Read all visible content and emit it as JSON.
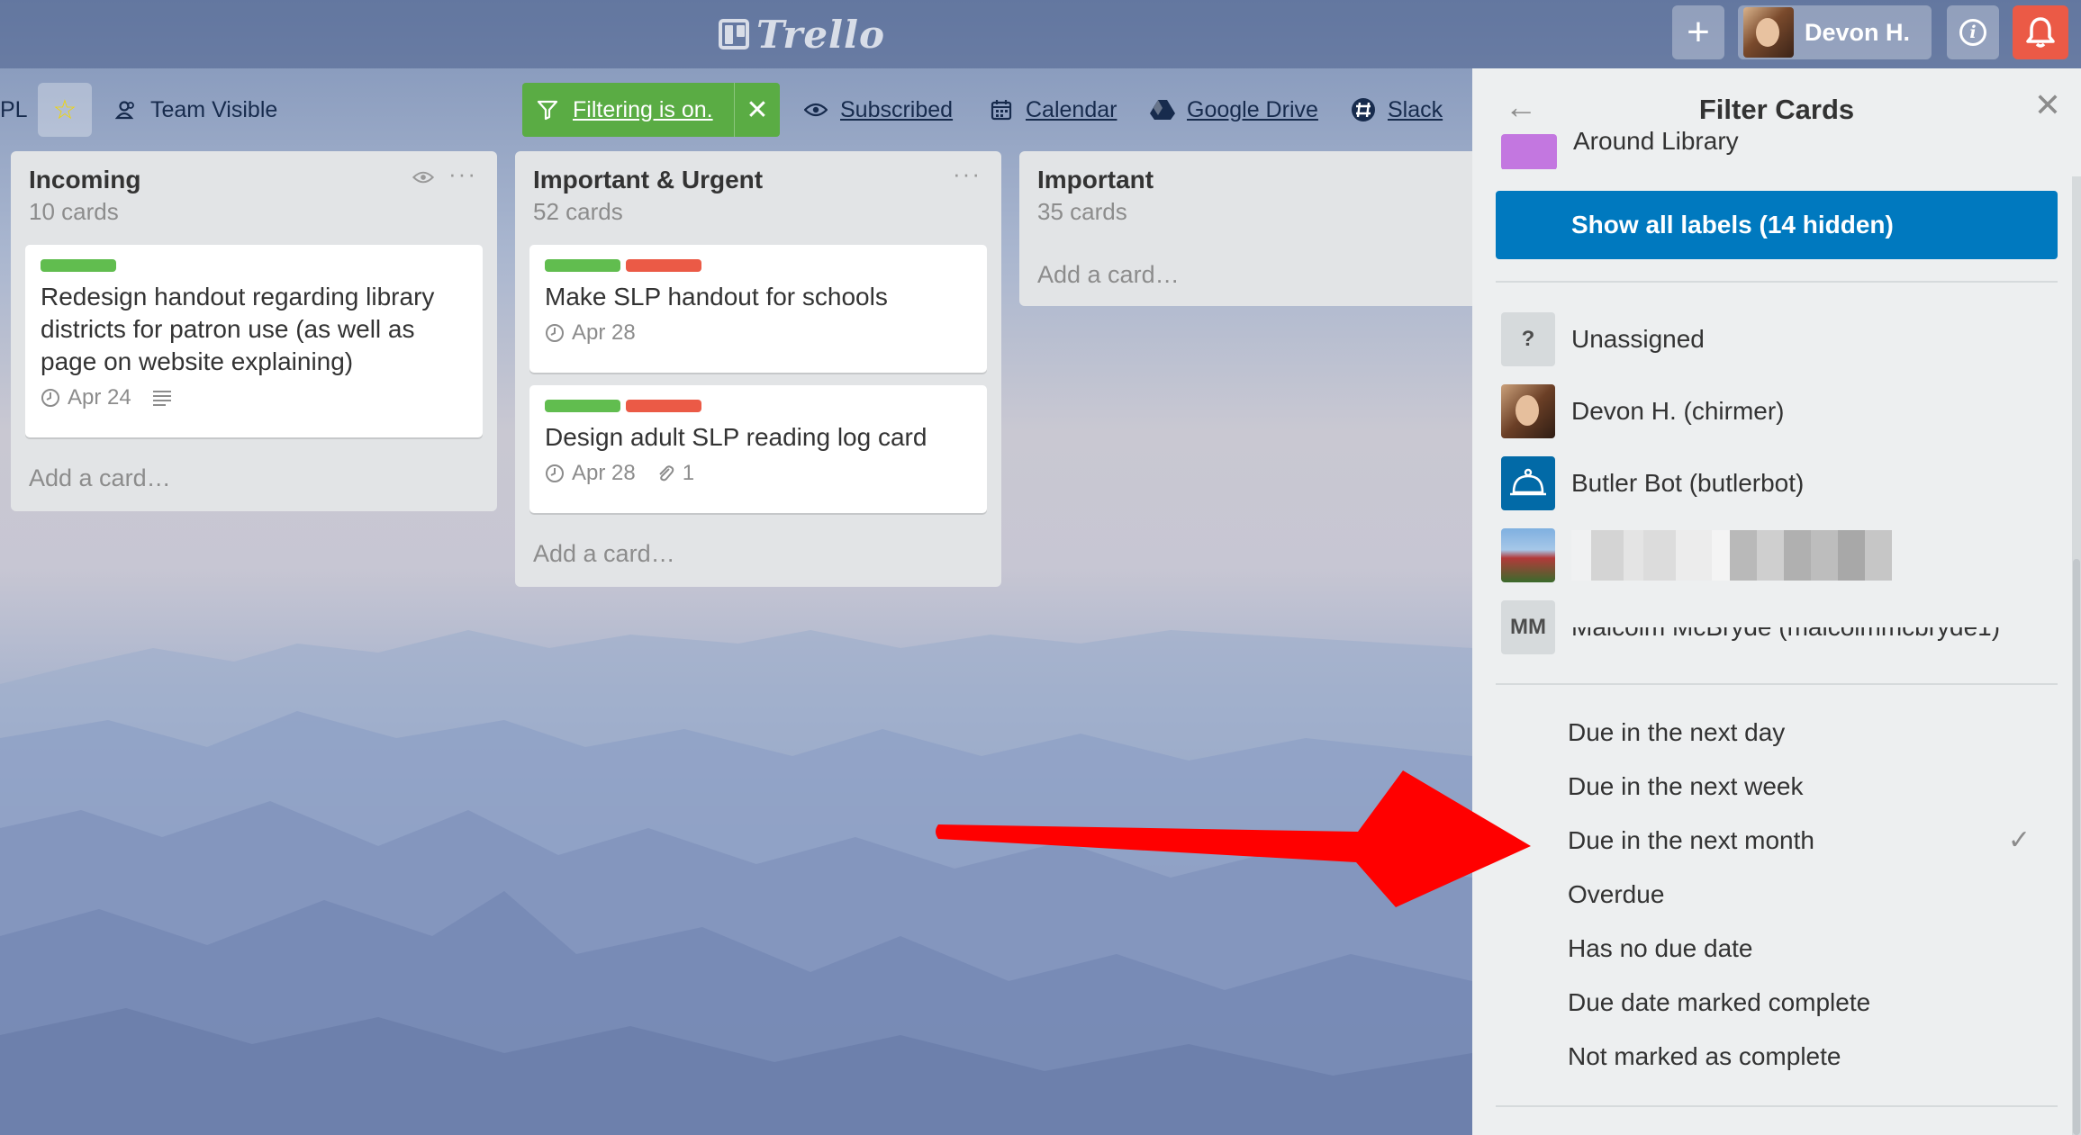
{
  "header": {
    "logo_text": "Trello",
    "plus_label": "+",
    "user_name": "Devon H.",
    "info_label": "i"
  },
  "boardbar": {
    "board_name_fragment": "PL",
    "visibility": "Team Visible",
    "filter_label": "Filtering is on.",
    "filter_clear": "✕",
    "subscribed": "Subscribed",
    "calendar": "Calendar",
    "google_drive": "Google Drive",
    "slack": "Slack"
  },
  "lists": [
    {
      "title": "Incoming",
      "count": "10 cards",
      "add_card": "Add a card…",
      "cards": [
        {
          "labels": [
            "#61bd4f"
          ],
          "title": "Redesign handout regarding library districts for patron use (as well as page on website explaining)",
          "due": "Apr 24",
          "has_description": true
        }
      ]
    },
    {
      "title": "Important & Urgent",
      "count": "52 cards",
      "add_card": "Add a card…",
      "cards": [
        {
          "labels": [
            "#61bd4f",
            "#eb5a46"
          ],
          "title": "Make SLP handout for schools",
          "due": "Apr 28"
        },
        {
          "labels": [
            "#61bd4f",
            "#eb5a46"
          ],
          "title": "Design adult SLP reading log card",
          "due": "Apr 28",
          "attachments": "1"
        }
      ]
    },
    {
      "title": "Important",
      "count": "35 cards",
      "add_card": "Add a card…"
    }
  ],
  "panel": {
    "title": "Filter Cards",
    "partial_label": "Around Library",
    "partial_label_color": "#c377e0",
    "show_all_labels": "Show all labels (14 hidden)",
    "members": [
      {
        "initials": "?",
        "name": "Unassigned"
      },
      {
        "name": "Devon H. (chirmer)"
      },
      {
        "name": "Butler Bot (butlerbot)"
      },
      {
        "name": ""
      },
      {
        "initials": "MM",
        "name": "Malcolm McBryde (malcolmmcbryde1)"
      }
    ],
    "due_options": [
      "Due in the next day",
      "Due in the next week",
      "Due in the next month",
      "Overdue",
      "Has no due date",
      "Due date marked complete",
      "Not marked as complete"
    ],
    "checked_option": "Due in the next month",
    "check_mark": "✓"
  },
  "colors": {
    "filter_green": "#5aac44",
    "show_all_blue": "#0079bf",
    "notification_red": "#eb5a46",
    "annotation_arrow": "#ff0000"
  }
}
